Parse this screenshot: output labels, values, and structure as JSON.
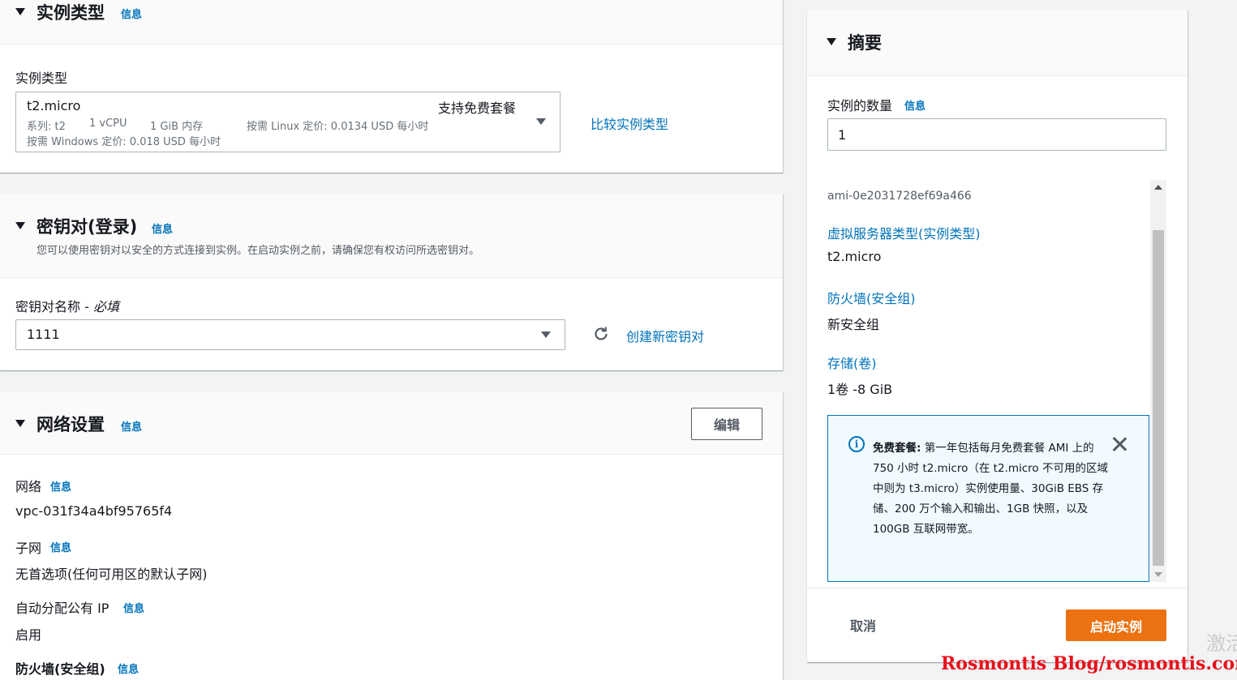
{
  "instance_type_section": {
    "title": "实例类型",
    "info": "信息",
    "field_label": "实例类型",
    "selected": {
      "name": "t2.micro",
      "badge": "支持免费套餐",
      "family": "系列: t2",
      "vcpu": "1 vCPU",
      "memory": "1 GiB 内存",
      "linux_price": "按需 Linux 定价: 0.0134 USD 每小时",
      "windows_price": "按需 Windows 定价: 0.018 USD 每小时"
    },
    "compare_link": "比较实例类型"
  },
  "keypair_section": {
    "title": "密钥对(登录)",
    "info": "信息",
    "description": "您可以使用密钥对以安全的方式连接到实例。在启动实例之前，请确保您有权访问所选密钥对。",
    "field_label": "密钥对名称 - ",
    "field_required": "必填",
    "selected": "1111",
    "create_link": "创建新密钥对"
  },
  "network_section": {
    "title": "网络设置",
    "info": "信息",
    "edit_button": "编辑",
    "network_label": "网络",
    "network_info": "信息",
    "network_value": "vpc-031f34a4bf95765f4",
    "subnet_label": "子网",
    "subnet_info": "信息",
    "subnet_value": "无首选项(任何可用区的默认子网)",
    "public_ip_label": "自动分配公有 IP",
    "public_ip_info": "信息",
    "public_ip_value": "启用",
    "firewall_label": "防火墙(安全组)",
    "firewall_info": "信息"
  },
  "summary": {
    "title": "摘要",
    "count_label": "实例的数量",
    "count_info": "信息",
    "count_value": "1",
    "ami_id": "ami-0e2031728ef69a466",
    "instance_type_link": "虚拟服务器类型(实例类型)",
    "instance_type_value": "t2.micro",
    "firewall_link": "防火墙(安全组)",
    "firewall_value": "新安全组",
    "storage_link": "存储(卷)",
    "storage_value": "1卷 -8 GiB",
    "alert": {
      "bold": "免费套餐:",
      "text": " 第一年包括每月免费套餐 AMI 上的 750 小时 t2.micro（在 t2.micro 不可用的区域中则为 t3.micro）实例使用量、30GiB EBS 存储、200 万个输入和输出、1GB 快照，以及 100GB 互联网带宽。"
    },
    "cancel_button": "取消",
    "launch_button": "启动实例"
  },
  "watermark": "Rosmontis Blog/rosmontis.com",
  "activate_text": "激活",
  "colors": {
    "link": "#0073bb",
    "primary_button": "#ec7211",
    "watermark": "#e8101a"
  }
}
